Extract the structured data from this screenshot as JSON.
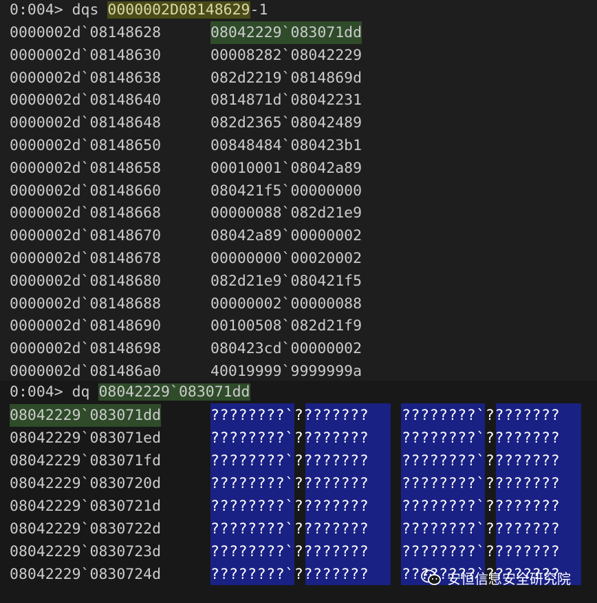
{
  "cmd1": {
    "prompt": "0:004> dqs ",
    "arg": "0000002D08148629",
    "suffix": "-1"
  },
  "dqs_rows": [
    {
      "addr": "0000002d`08148628",
      "val": "08042229`083071dd"
    },
    {
      "addr": "0000002d`08148630",
      "val": "00008282`08042229"
    },
    {
      "addr": "0000002d`08148638",
      "val": "082d2219`0814869d"
    },
    {
      "addr": "0000002d`08148640",
      "val": "0814871d`08042231"
    },
    {
      "addr": "0000002d`08148648",
      "val": "082d2365`08042489"
    },
    {
      "addr": "0000002d`08148650",
      "val": "00848484`080423b1"
    },
    {
      "addr": "0000002d`08148658",
      "val": "00010001`08042a89"
    },
    {
      "addr": "0000002d`08148660",
      "val": "080421f5`00000000"
    },
    {
      "addr": "0000002d`08148668",
      "val": "00000088`082d21e9"
    },
    {
      "addr": "0000002d`08148670",
      "val": "08042a89`00000002"
    },
    {
      "addr": "0000002d`08148678",
      "val": "00000000`00020002"
    },
    {
      "addr": "0000002d`08148680",
      "val": "082d21e9`080421f5"
    },
    {
      "addr": "0000002d`08148688",
      "val": "00000002`00000088"
    },
    {
      "addr": "0000002d`08148690",
      "val": "00100508`082d21f9"
    },
    {
      "addr": "0000002d`08148698",
      "val": "080423cd`00000002"
    },
    {
      "addr": "0000002d`081486a0",
      "val": "40019999`9999999a"
    }
  ],
  "cmd2": {
    "prompt": "0:004> dq ",
    "arg": "08042229`083071dd"
  },
  "dq_rows": [
    {
      "addr": "08042229`083071dd",
      "q1": "????????`????????",
      "q2": "????????`????????"
    },
    {
      "addr": "08042229`083071ed",
      "q1": "????????`????????",
      "q2": "????????`????????"
    },
    {
      "addr": "08042229`083071fd",
      "q1": "????????`????????",
      "q2": "????????`????????"
    },
    {
      "addr": "08042229`0830720d",
      "q1": "????????`????????",
      "q2": "????????`????????"
    },
    {
      "addr": "08042229`0830721d",
      "q1": "????????`????????",
      "q2": "????????`????????"
    },
    {
      "addr": "08042229`0830722d",
      "q1": "????????`????????",
      "q2": "????????`????????"
    },
    {
      "addr": "08042229`0830723d",
      "q1": "????????`????????",
      "q2": "????????`????????"
    },
    {
      "addr": "08042229`0830724d",
      "q1": "????????`????????",
      "q2": "????????`????????"
    }
  ],
  "watermark": {
    "text": "安恒信息安全研究院",
    "icon": "wechat-icon"
  },
  "colors": {
    "background": "#1e1e1e",
    "text": "#cccccc",
    "command_highlight": "#4b4b18",
    "match_highlight": "#2f4b2a",
    "unreadable_memory": "#1a2184"
  }
}
